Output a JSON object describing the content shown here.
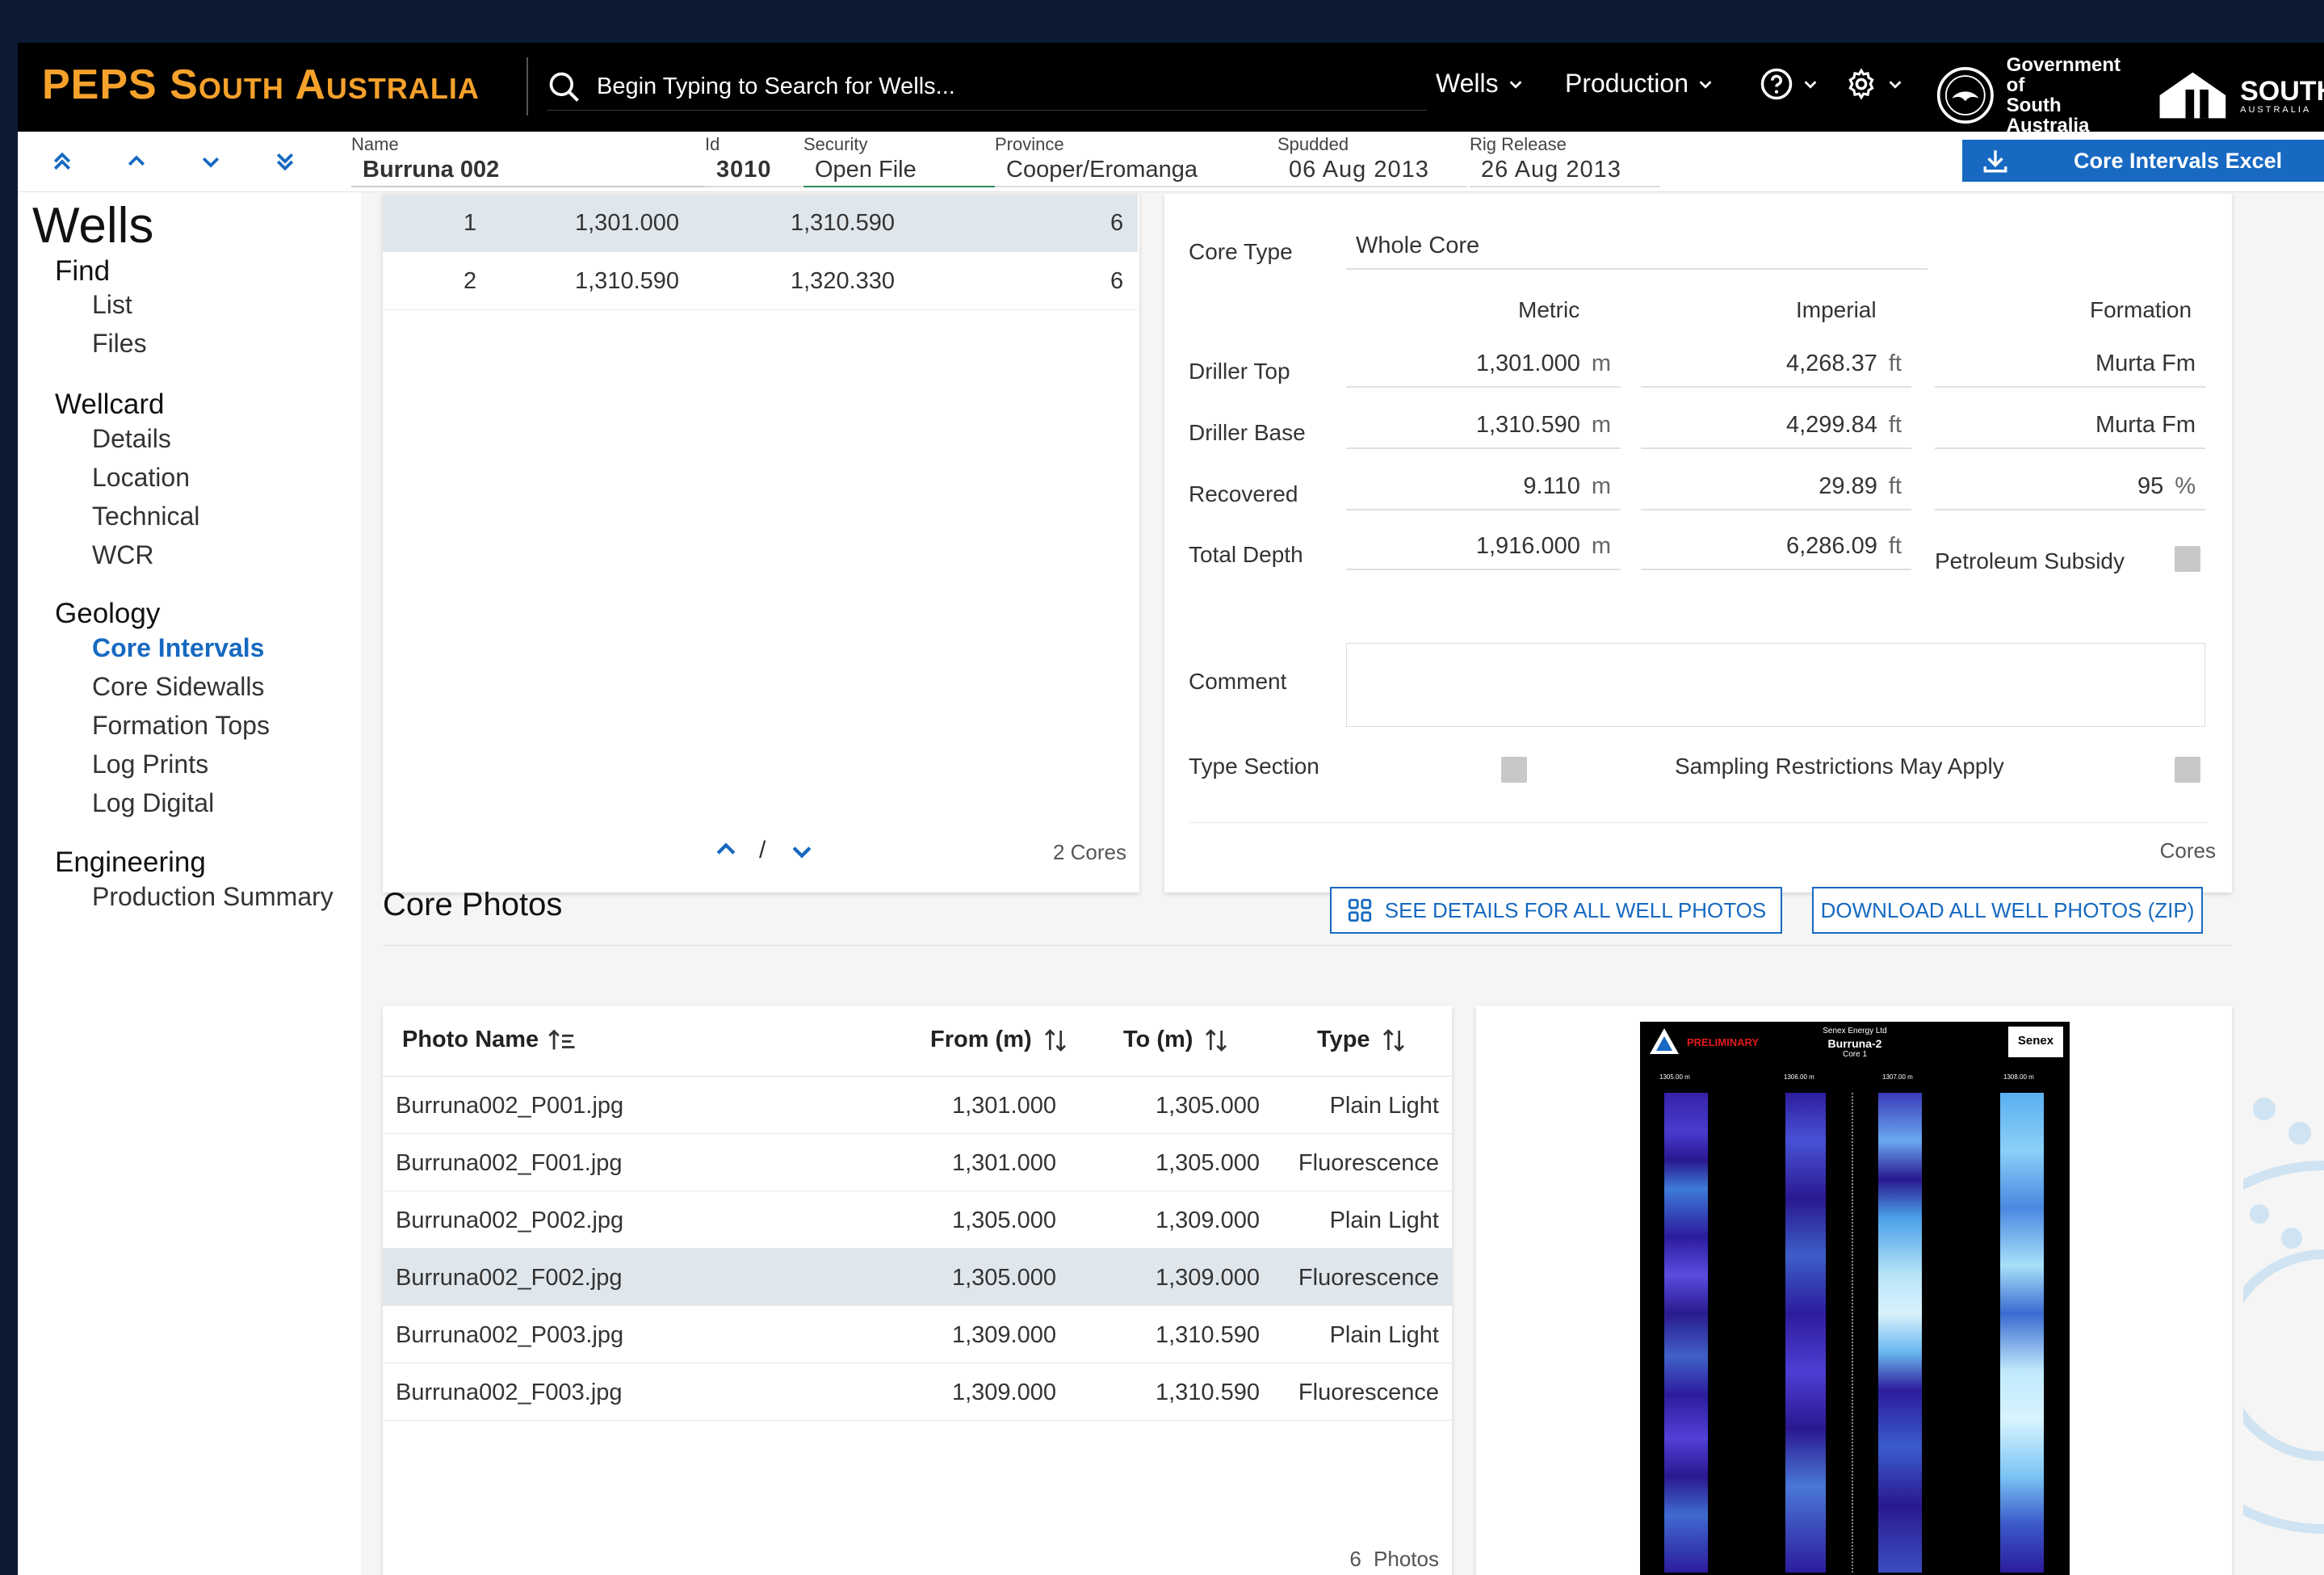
{
  "header": {
    "brand": "PEPS South Australia",
    "search_placeholder": "Begin Typing to Search for Wells...",
    "menus": [
      "Wells",
      "Production"
    ],
    "gov_line1": "Government of",
    "gov_line2": "South Australia",
    "sa_logo_text": "SOUTH",
    "sa_logo_sub": "AUSTRALIA"
  },
  "toolbar": {
    "fields": [
      {
        "label": "Name",
        "value": "Burruna 002"
      },
      {
        "label": "Id",
        "value": "3010"
      },
      {
        "label": "Security",
        "value": "Open File"
      },
      {
        "label": "Province",
        "value": "Cooper/Eromanga"
      },
      {
        "label": "Spudded",
        "value": "06 Aug 2013"
      },
      {
        "label": "Rig Release",
        "value": "26 Aug 2013"
      }
    ],
    "excel_button": "Core Intervals Excel"
  },
  "sidebar": {
    "title": "Wells",
    "find": "Find",
    "find_items": [
      "List",
      "Files"
    ],
    "wellcard": "Wellcard",
    "wellcard_items": [
      "Details",
      "Location",
      "Technical",
      "WCR"
    ],
    "geology": "Geology",
    "geology_items": [
      "Core Intervals",
      "Core Sidewalls",
      "Formation Tops",
      "Log Prints",
      "Log Digital"
    ],
    "engineering": "Engineering",
    "engineering_items": [
      "Production Summary"
    ]
  },
  "core_intervals": {
    "rows": [
      {
        "no": "1",
        "top": "1,301.000",
        "base": "1,310.590",
        "count": "6"
      },
      {
        "no": "2",
        "top": "1,310.590",
        "base": "1,320.330",
        "count": "6"
      }
    ],
    "pager_sep": "/",
    "footer": "2 Cores"
  },
  "core_detail": {
    "core_type_label": "Core Type",
    "core_type_value": "Whole Core",
    "col_metric": "Metric",
    "col_imperial": "Imperial",
    "col_formation": "Formation",
    "rows": [
      {
        "label": "Driller Top",
        "metric": "1,301.000",
        "m_unit": "m",
        "imperial": "4,268.37",
        "i_unit": "ft",
        "formation": "Murta Fm"
      },
      {
        "label": "Driller Base",
        "metric": "1,310.590",
        "m_unit": "m",
        "imperial": "4,299.84",
        "i_unit": "ft",
        "formation": "Murta Fm"
      },
      {
        "label": "Recovered",
        "metric": "9.110",
        "m_unit": "m",
        "imperial": "29.89",
        "i_unit": "ft",
        "formation": "95",
        "f_unit": "%"
      },
      {
        "label": "Total Depth",
        "metric": "1,916.000",
        "m_unit": "m",
        "imperial": "6,286.09",
        "i_unit": "ft"
      }
    ],
    "petroleum_subsidy": "Petroleum Subsidy",
    "comment_label": "Comment",
    "comment_value": "",
    "type_section": "Type Section",
    "sampling": "Sampling Restrictions May Apply",
    "footer": "Cores"
  },
  "core_photos": {
    "title": "Core Photos",
    "see_details_btn": "SEE DETAILS FOR ALL WELL PHOTOS",
    "download_btn": "DOWNLOAD ALL WELL PHOTOS (ZIP)",
    "columns": [
      "Photo Name",
      "From (m)",
      "To (m)",
      "Type"
    ],
    "rows": [
      {
        "name": "Burruna002_P001.jpg",
        "from": "1,301.000",
        "to": "1,305.000",
        "type": "Plain Light"
      },
      {
        "name": "Burruna002_F001.jpg",
        "from": "1,301.000",
        "to": "1,305.000",
        "type": "Fluorescence"
      },
      {
        "name": "Burruna002_P002.jpg",
        "from": "1,305.000",
        "to": "1,309.000",
        "type": "Plain Light"
      },
      {
        "name": "Burruna002_F002.jpg",
        "from": "1,305.000",
        "to": "1,309.000",
        "type": "Fluorescence"
      },
      {
        "name": "Burruna002_P003.jpg",
        "from": "1,309.000",
        "to": "1,310.590",
        "type": "Plain Light"
      },
      {
        "name": "Burruna002_F003.jpg",
        "from": "1,309.000",
        "to": "1,310.590",
        "type": "Fluorescence"
      }
    ],
    "footer_count": "6",
    "footer_label": "Photos"
  },
  "photo_preview": {
    "preliminary": "PRELIMINARY",
    "company": "Senex Energy Ltd",
    "well": "Burruna-2",
    "core": "Core 1",
    "logo": "Senex",
    "depth_marks": [
      "1305.00 m",
      "1306.00 m",
      "1307.00 m",
      "1308.00 m"
    ]
  },
  "colors": {
    "brand_orange": "#f6a12b",
    "accent_blue": "#1769c1",
    "selected_row": "#dfe6ec",
    "page_bg": "#0c1a33"
  }
}
